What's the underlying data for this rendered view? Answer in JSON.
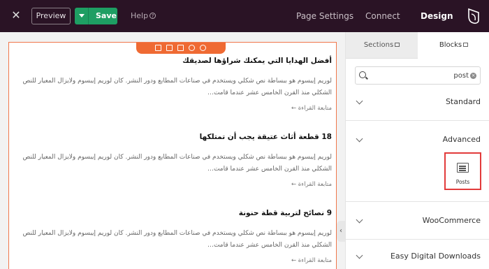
{
  "topbar": {
    "preview_label": "Preview",
    "save_label": "Save",
    "help_label": "Help",
    "tabs": [
      "Page Settings",
      "Connect",
      "Design"
    ],
    "active_tab": "Design"
  },
  "posts": [
    {
      "title": "أفضل الهدايا التي يمكنك شراؤها لصديقك",
      "body": "لوريم إيبسوم هو ببساطة نص شكلي ويستخدم في صناعات المطابع ودور النشر. كان لوريم إيبسوم ولايزال المعيار للنص الشكلي منذ القرن الخامس عشر عندما قامت…",
      "more": "متابعة القراءة ←"
    },
    {
      "title": "18 قطعة أثاث عتيقة يجب أن تمتلكها",
      "body": "لوريم إيبسوم هو ببساطة نص شكلي ويستخدم في صناعات المطابع ودور النشر. كان لوريم إيبسوم ولايزال المعيار للنص الشكلي منذ القرن الخامس عشر عندما قامت…",
      "more": "متابعة القراءة ←"
    },
    {
      "title": "9 نصائح لتربية قطة حنونة",
      "body": "لوريم إيبسوم هو ببساطة نص شكلي ويستخدم في صناعات المطابع ودور النشر. كان لوريم إيبسوم ولايزال المعيار للنص الشكلي منذ القرن الخامس عشر عندما قامت…",
      "more": "متابعة القراءة ←"
    }
  ],
  "panel": {
    "tabs": {
      "sections": "Sections",
      "blocks": "Blocks"
    },
    "search_value": "post",
    "categories": [
      "Standard",
      "Advanced",
      "WooCommerce",
      "Easy Digital Downloads"
    ],
    "block": {
      "label": "Posts",
      "icon": "posts-icon"
    }
  },
  "colors": {
    "topbar_bg": "#2a1325",
    "save_green": "#1e9e63",
    "selection_orange": "#ef6a33",
    "highlight_red": "#e23b3b"
  }
}
